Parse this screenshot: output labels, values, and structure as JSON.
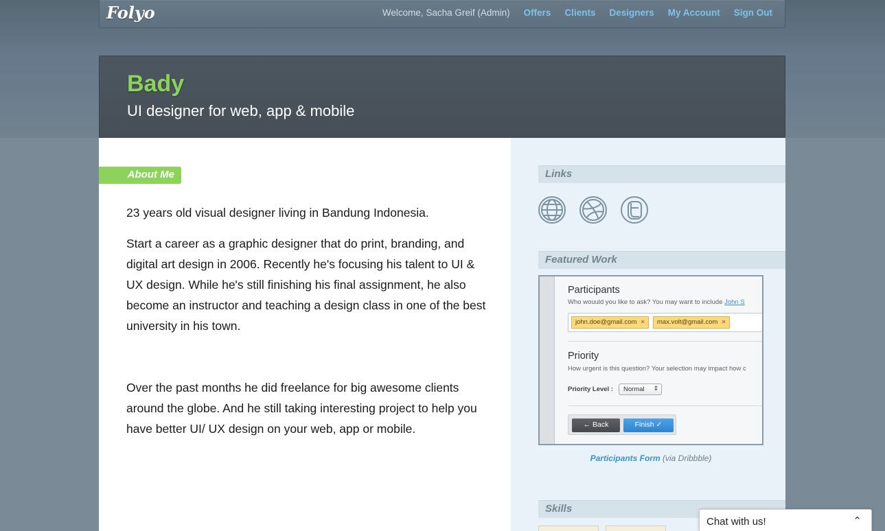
{
  "nav": {
    "logo": "Folyo",
    "welcome": "Welcome, Sacha Greif (Admin)",
    "links": [
      "Offers",
      "Clients",
      "Designers",
      "My Account",
      "Sign Out"
    ]
  },
  "profile": {
    "name": "Bady",
    "tagline": "UI designer for web, app & mobile"
  },
  "about": {
    "label": "About Me",
    "paragraphs": [
      "23 years old visual designer living in Bandung Indonesia.",
      "Start a career as a graphic designer that do print, branding, and digital art design in 2006. Recently he's focusing his talent to UI & UX design. While he's still finishing his final assignment, he also become an instructor and teaching a design class in one of the best university in his town.",
      "Over the past months he did freelance for big awesome clients around the globe. And he still taking interesting project to help you have better UI/ UX design on your web, app or mobile."
    ]
  },
  "sidebar": {
    "links_label": "Links",
    "link_icons": [
      "globe-icon",
      "dribbble-icon",
      "twitter-icon"
    ],
    "featured_label": "Featured Work",
    "featured": {
      "participants_title": "Participants",
      "participants_sub": "Who wouuld you like to ask? You may want to include",
      "participants_link": "John S",
      "tags": [
        "john.doe@gmail.com",
        "max.volt@gmail.com"
      ],
      "tag_remove": "×",
      "priority_title": "Priority",
      "priority_sub": "How urgent is this question? Your selection may impact how c",
      "priority_level_label": "Priority Level :",
      "priority_value": "Normal",
      "back_label": "← Back",
      "finish_label": "Finish ✓"
    },
    "caption_title": "Participants Form",
    "caption_via": " (via Dribbble)",
    "skills_label": "Skills"
  },
  "chat": {
    "label": "Chat with us!",
    "chevron": "⌃"
  },
  "colors": {
    "accent_green": "#8bd35a",
    "link_blue": "#7cc3ec",
    "header_dark": "#4a535b"
  }
}
